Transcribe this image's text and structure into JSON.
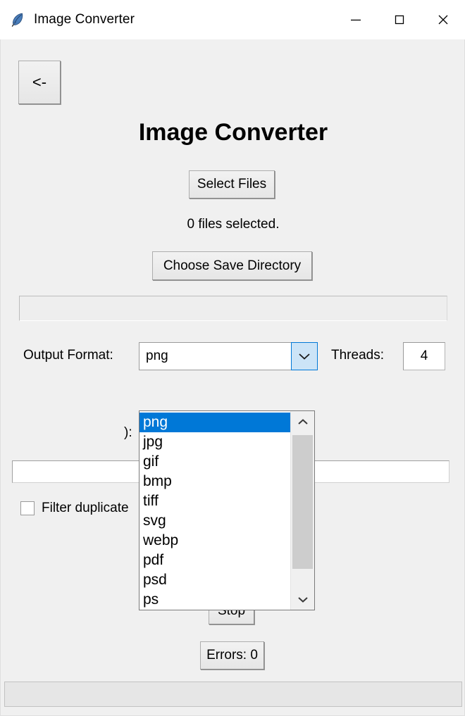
{
  "window": {
    "title": "Image Converter",
    "icon": "feather-icon",
    "controls": {
      "minimize": "minimize-icon",
      "maximize": "maximize-icon",
      "close": "close-icon"
    }
  },
  "main": {
    "back_button": "<-",
    "heading": "Image Converter",
    "select_files_button": "Select Files",
    "files_selected_status": "0 files selected.",
    "choose_save_directory_button": "Choose Save Directory",
    "progress": {
      "value": 0,
      "label": ""
    },
    "output_format": {
      "label": "Output Format:",
      "value": "png",
      "arrow_icon": "chevron-down-icon",
      "options": [
        "png",
        "jpg",
        "gif",
        "bmp",
        "tiff",
        "svg",
        "webp",
        "pdf",
        "psd",
        "ps"
      ],
      "visible_options": [
        "png",
        "jpg",
        "gif",
        "bmp",
        "tiff",
        "svg",
        "webp",
        "pdf",
        "psd",
        "ps"
      ],
      "selected_option": "png",
      "open": true,
      "highlight_color": "#0078d7"
    },
    "threads": {
      "label": "Threads:",
      "value": "4"
    },
    "pattern": {
      "label": "):",
      "value": "",
      "placeholder": ""
    },
    "filter_duplicates": {
      "label": "Filter duplicate",
      "checked": false
    },
    "stop_button": "Stop",
    "errors_button": "Errors: 0",
    "status_panel_text": ""
  },
  "colors": {
    "window_background": "#f0f0f0",
    "titlebar_background": "#ffffff",
    "accent": "#0078d7",
    "combo_button_fill": "#cce4f7",
    "scrollbar_thumb": "#cdcdcd",
    "status_panel": "#e6e6e6"
  }
}
